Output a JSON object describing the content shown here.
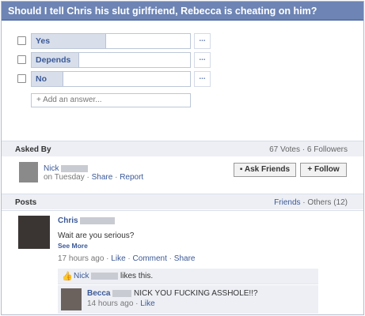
{
  "question": {
    "title": "Should I tell Chris his slut girlfriend, Rebecca is cheating on him?"
  },
  "options": [
    {
      "label": "Yes",
      "fill_fraction": 0.47
    },
    {
      "label": "Depends",
      "fill_fraction": 0.3
    },
    {
      "label": "No",
      "fill_fraction": 0.2
    }
  ],
  "more_label": "...",
  "add_answer": "+ Add an answer...",
  "asked_by": {
    "label": "Asked By",
    "stats": "67 Votes · 6 Followers",
    "name": "Nick",
    "time": "on Tuesday",
    "share": "Share",
    "report": "Report",
    "ask_friends": "Ask Friends",
    "follow": "Follow"
  },
  "posts": {
    "label": "Posts",
    "friends": "Friends",
    "others": "Others (12)"
  },
  "comment": {
    "name": "Chris",
    "text": "Wait are you serious?",
    "see_more": "See More",
    "time": "17 hours ago",
    "like": "Like",
    "comment": "Comment",
    "share": "Share"
  },
  "likes": {
    "name": "Nick",
    "text": "likes this."
  },
  "reply": {
    "name": "Becca",
    "text": "NICK YOU FUCKING ASSHOLE!!?",
    "time": "14 hours ago",
    "like": "Like"
  },
  "colors": {
    "header": "#6d84b4",
    "link": "#3b5998",
    "option_fill": "#d8dfea"
  }
}
